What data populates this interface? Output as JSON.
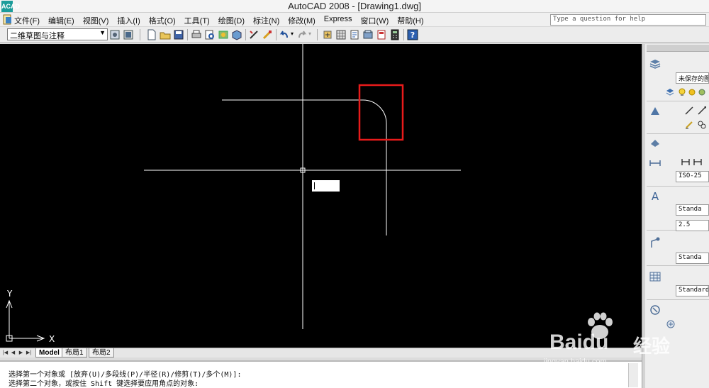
{
  "window": {
    "title": "AutoCAD 2008 - [Drawing1.dwg]",
    "logo_text": "ACAD"
  },
  "menubar": {
    "items": [
      "文件(F)",
      "编辑(E)",
      "视图(V)",
      "插入(I)",
      "格式(O)",
      "工具(T)",
      "绘图(D)",
      "标注(N)",
      "修改(M)",
      "Express",
      "窗口(W)",
      "帮助(H)"
    ],
    "help_placeholder": "Type a question for help"
  },
  "toolbar": {
    "workspace": "二维草图与注释",
    "icons": [
      "workspace-settings-icon",
      "workspace-icon",
      "new-icon",
      "open-icon",
      "save-icon",
      "plot-icon",
      "plot-preview-icon",
      "publish-icon",
      "3d-dwf-icon",
      "cut-icon",
      "copy-icon",
      "match-properties-icon",
      "undo-icon",
      "redo-icon",
      "pan-icon",
      "zoom-icon",
      "properties-icon",
      "design-center-icon",
      "tool-palettes-icon",
      "sheet-set-icon",
      "markup-icon",
      "calculator-icon",
      "help-icon"
    ]
  },
  "canvas": {
    "background": "#000000",
    "highlight_color": "#e81b1b",
    "ucs": {
      "x_label": "X",
      "y_label": "Y"
    }
  },
  "tabs": {
    "items": [
      "Model",
      "布局1",
      "布局2"
    ],
    "active": "Model"
  },
  "command": {
    "line1": "选择第一个对象或 [放弃(U)/多段线(P)/半径(R)/修剪(T)/多个(M)]:",
    "line2": "选择第二个对象，或按住 Shift 键选择要应用角点的对象:"
  },
  "palette": {
    "layer_field": "未保存的图",
    "dim_style": "ISO-25",
    "text_style": "Standa",
    "text_height": "2.5",
    "mleader_style": "Standa",
    "table_style": "Standard"
  },
  "watermark": {
    "brand": "Baidu",
    "brand_cn": "经验",
    "url": "jingyan.baidu.com"
  }
}
